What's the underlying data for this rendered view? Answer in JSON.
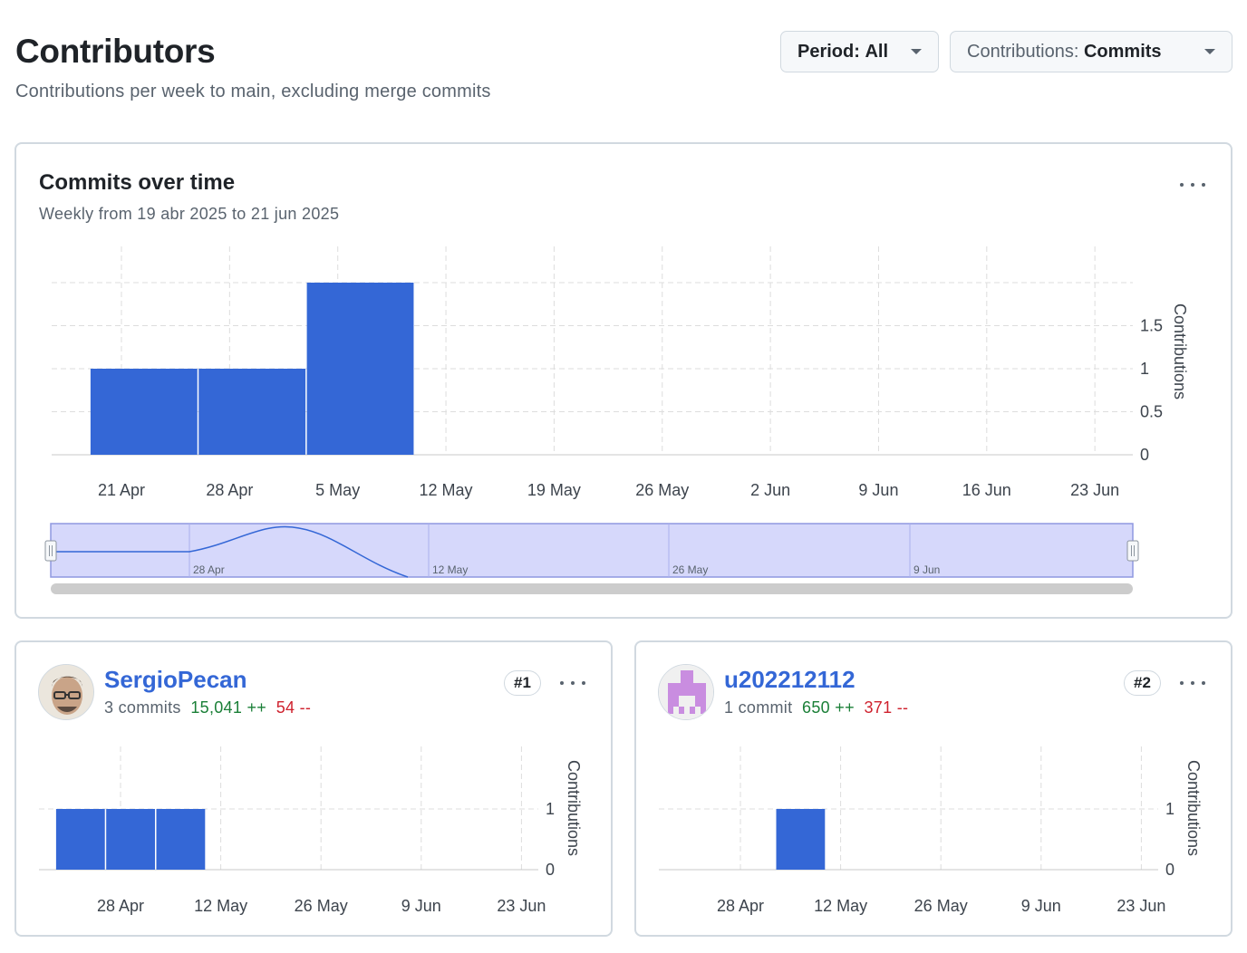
{
  "header": {
    "title": "Contributors",
    "subtitle": "Contributions per week to main, excluding merge commits"
  },
  "controls": {
    "period_key": "Period:",
    "period_value": "All",
    "contrib_key": "Contributions:",
    "contrib_value": "Commits"
  },
  "main_chart": {
    "title": "Commits over time",
    "subtitle": "Weekly from 19 abr 2025 to 21 jun 2025",
    "menu_icon": "kebab-horizontal-icon"
  },
  "navigator": {
    "labels": [
      "28 Apr",
      "12 May",
      "26 May",
      "9 Jun"
    ]
  },
  "contributors": [
    {
      "rank": "#1",
      "username": "SergioPecan",
      "commits": "3 commits",
      "additions": "15,041 ++",
      "deletions": "54 --",
      "avatar_icon": "user-photo-avatar"
    },
    {
      "rank": "#2",
      "username": "u202212112",
      "commits": "1 commit",
      "additions": "650 ++",
      "deletions": "371 --",
      "avatar_icon": "identicon-avatar"
    }
  ],
  "colors": {
    "bar": "#3467d6",
    "additions": "#1a7f37",
    "deletions": "#cf222e",
    "navigator_fill": "#d6d8fb"
  },
  "chart_data": [
    {
      "type": "bar",
      "title": "Commits over time",
      "ylabel": "Contributions",
      "x_ticks": [
        "21 Apr",
        "28 Apr",
        "5 May",
        "12 May",
        "19 May",
        "26 May",
        "2 Jun",
        "9 Jun",
        "16 Jun",
        "23 Jun"
      ],
      "y_ticks": [
        "0",
        "0.5",
        "1",
        "1.5"
      ],
      "ylim": [
        0,
        2
      ],
      "grid": true,
      "bars": [
        {
          "week": "19 Apr",
          "value": 1
        },
        {
          "week": "26 Apr",
          "value": 1
        },
        {
          "week": "3 May",
          "value": 2
        }
      ]
    },
    {
      "type": "bar",
      "title": "SergioPecan",
      "ylabel": "Contributions",
      "x_ticks": [
        "28 Apr",
        "12 May",
        "26 May",
        "9 Jun",
        "23 Jun"
      ],
      "y_ticks": [
        "0",
        "1"
      ],
      "ylim": [
        0,
        1
      ],
      "grid": true,
      "bars": [
        {
          "week": "19 Apr",
          "value": 1
        },
        {
          "week": "26 Apr",
          "value": 1
        },
        {
          "week": "3 May",
          "value": 1
        }
      ]
    },
    {
      "type": "bar",
      "title": "u202212112",
      "ylabel": "Contributions",
      "x_ticks": [
        "28 Apr",
        "12 May",
        "26 May",
        "9 Jun",
        "23 Jun"
      ],
      "y_ticks": [
        "0",
        "1"
      ],
      "ylim": [
        0,
        1
      ],
      "grid": true,
      "bars": [
        {
          "week": "3 May",
          "value": 1
        }
      ]
    }
  ]
}
